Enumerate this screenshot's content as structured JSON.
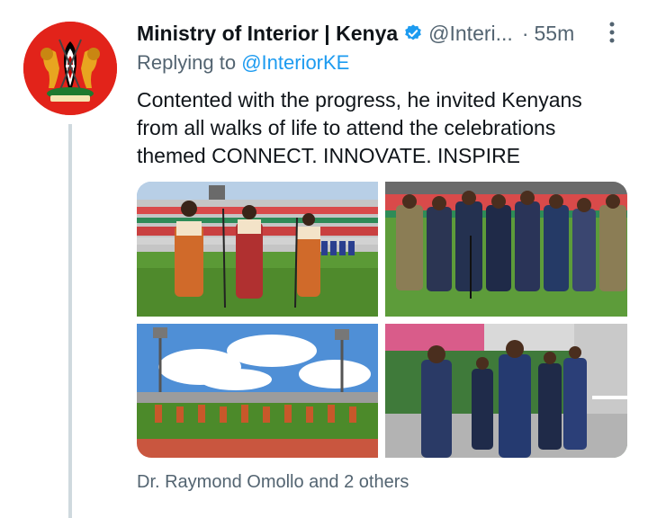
{
  "account": {
    "display_name": "Ministry of Interior | Kenya",
    "handle": "@Interi...",
    "separator": "·",
    "timestamp": "55m",
    "verified": true,
    "avatar_icon": "kenya-coat-of-arms-icon"
  },
  "reply": {
    "prefix": "Replying to",
    "mention": "@InteriorKE"
  },
  "tweet": {
    "lines": [
      "Contented with the progress, he invited Kenyans",
      "from all walks of life to attend the celebrations",
      "themed CONNECT. INNOVATE. INSPIRE"
    ]
  },
  "tagged": {
    "text": "Dr. Raymond Omollo and 2 others"
  },
  "colors": {
    "accent": "#1d9bf0",
    "secondary_text": "#536471",
    "thread_line": "#cfd9de",
    "avatar_bg": "#e2231a"
  }
}
